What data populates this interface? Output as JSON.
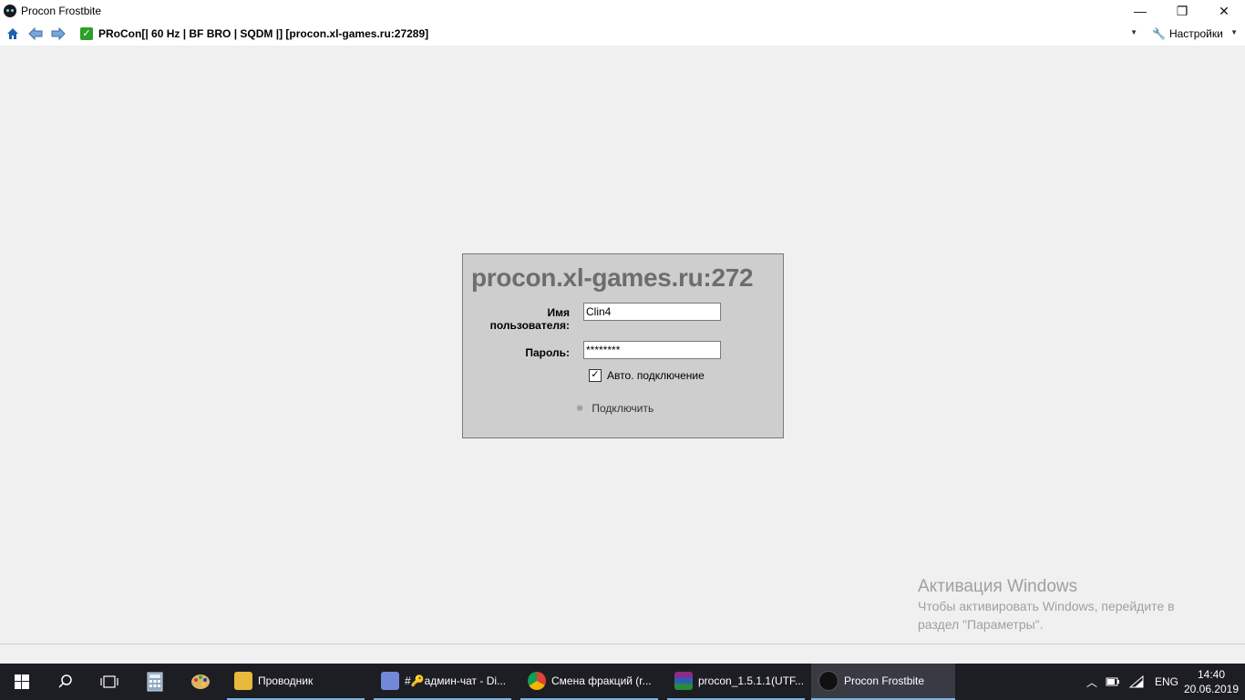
{
  "window": {
    "title": "Procon Frostbite",
    "minimize": "—",
    "restore": "❐",
    "close": "✕"
  },
  "toolbar": {
    "connection": "PRoCon[| 60 Hz | BF BRO | SQDM |] [procon.xl-games.ru:27289]",
    "settings_label": "Настройки"
  },
  "login": {
    "host": "procon.xl-games.ru:272",
    "username_label": "Имя пользователя:",
    "username_value": "Clin4",
    "password_label": "Пароль:",
    "password_value": "********",
    "auto_connect_label": "Авто. подключение",
    "auto_connect_checked": true,
    "connect_label": "Подключить"
  },
  "watermark": {
    "title": "Активация Windows",
    "line1": "Чтобы активировать Windows, перейдите в",
    "line2": "раздел \"Параметры\"."
  },
  "taskbar": {
    "items": [
      {
        "label": "Проводник",
        "icon": "folder-icon"
      },
      {
        "label": "#🔑админ-чат - Di...",
        "icon": "discord-icon"
      },
      {
        "label": "Смена фракций (r...",
        "icon": "chrome-icon"
      },
      {
        "label": "procon_1.5.1.1(UTF...",
        "icon": "winrar-icon"
      },
      {
        "label": "Procon Frostbite",
        "icon": "procon-icon"
      }
    ],
    "language": "ENG",
    "time": "14:40",
    "date": "20.06.2019"
  }
}
